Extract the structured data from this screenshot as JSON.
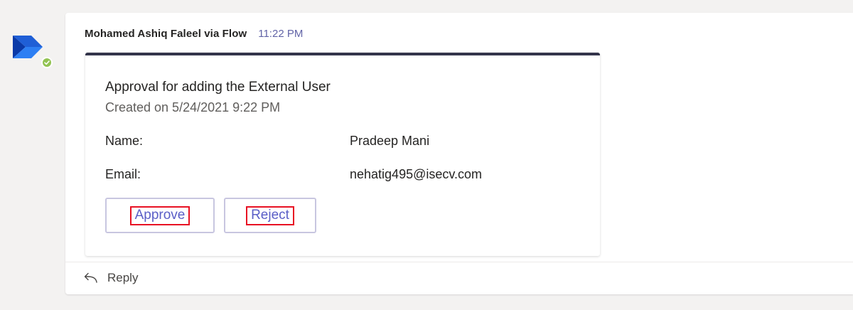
{
  "message": {
    "sender": "Mohamed Ashiq Faleel via Flow",
    "timestamp": "11:22 PM",
    "avatar_icon": "power-automate-icon",
    "presence_status": "available"
  },
  "card": {
    "title": "Approval for adding the External User",
    "subtitle": "Created on 5/24/2021 9:22 PM",
    "fields": [
      {
        "label": "Name:",
        "value": "Pradeep Mani"
      },
      {
        "label": "Email:",
        "value": "nehatig495@isecv.com"
      }
    ],
    "actions": [
      {
        "label": "Approve"
      },
      {
        "label": "Reject"
      }
    ],
    "accent_color": "#33344a",
    "button_text_color": "#5b5fc7",
    "highlight_color": "#e81123"
  },
  "reply": {
    "label": "Reply",
    "icon": "reply-arrow-icon"
  },
  "colors": {
    "background": "#f3f2f1",
    "timestamp": "#6264a7",
    "presence": "#92c353"
  }
}
